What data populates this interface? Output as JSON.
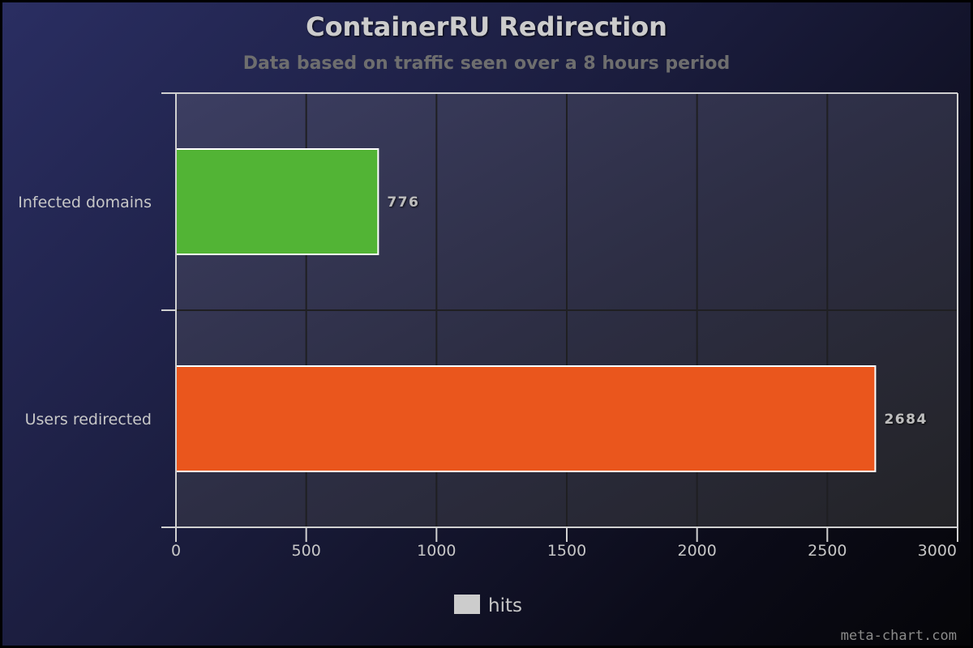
{
  "chart_data": {
    "type": "bar",
    "orientation": "horizontal",
    "title": "ContainerRU Redirection",
    "subtitle": "Data based on traffic seen over a 8 hours period",
    "categories": [
      "Infected domains",
      "Users redirected"
    ],
    "series": [
      {
        "name": "hits",
        "values": [
          776,
          2684
        ]
      }
    ],
    "bar_colors": [
      "#52b435",
      "#ea561d"
    ],
    "xlim": [
      0,
      3000
    ],
    "xticks": [
      0,
      500,
      1000,
      1500,
      2000,
      2500,
      3000
    ],
    "grid": true,
    "legend": {
      "position": "bottom-center",
      "swatch_color": "#cccccc"
    },
    "data_labels": true
  },
  "watermark": "meta-chart.com"
}
